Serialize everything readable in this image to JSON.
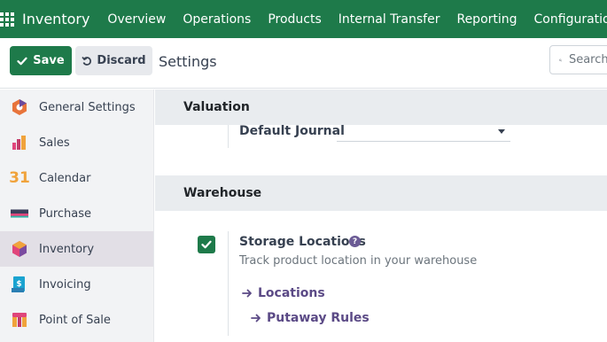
{
  "navbar": {
    "app_name": "Inventory",
    "menu": [
      "Overview",
      "Operations",
      "Products",
      "Internal Transfer",
      "Reporting",
      "Configuration"
    ]
  },
  "toolbar": {
    "save_label": "Save",
    "discard_label": "Discard",
    "title": "Settings",
    "search_placeholder": "Search..."
  },
  "sidebar": {
    "items": [
      {
        "label": "General Settings",
        "icon": "general-settings-icon"
      },
      {
        "label": "Sales",
        "icon": "sales-icon"
      },
      {
        "label": "Calendar",
        "icon": "calendar-icon",
        "icon_text": "31"
      },
      {
        "label": "Purchase",
        "icon": "purchase-icon"
      },
      {
        "label": "Inventory",
        "icon": "inventory-icon",
        "active": true
      },
      {
        "label": "Invoicing",
        "icon": "invoicing-icon"
      },
      {
        "label": "Point of Sale",
        "icon": "point-of-sale-icon"
      }
    ]
  },
  "sections": {
    "valuation": {
      "title": "Valuation",
      "default_journal_label": "Default Journal",
      "default_journal_value": ""
    },
    "warehouse": {
      "title": "Warehouse",
      "storage_locations": {
        "label": "Storage Locations",
        "checked": true,
        "description": "Track product location in your warehouse",
        "links": [
          "Locations",
          "Putaway Rules"
        ]
      }
    }
  },
  "colors": {
    "brand_green": "#1e7a4a",
    "link_purple": "#5b4a86"
  }
}
